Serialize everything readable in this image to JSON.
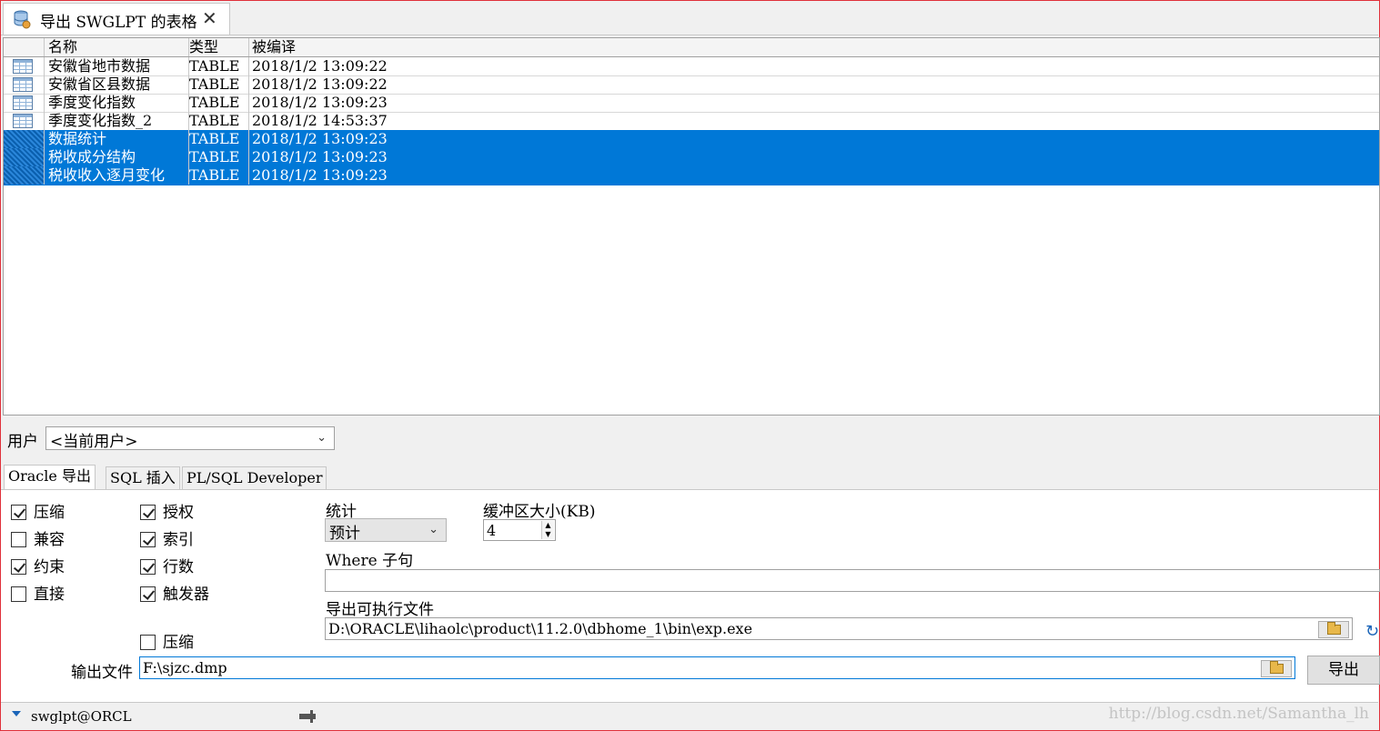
{
  "tab": {
    "title": "导出 SWGLPT 的表格",
    "icon": "database-icon",
    "close": "✕"
  },
  "grid": {
    "columns": [
      "名称",
      "类型",
      "被编译"
    ],
    "rows": [
      {
        "name": "安徽省地市数据",
        "type": "TABLE",
        "compiled": "2018/1/2 13:09:22",
        "selected": false
      },
      {
        "name": "安徽省区县数据",
        "type": "TABLE",
        "compiled": "2018/1/2 13:09:22",
        "selected": false
      },
      {
        "name": "季度变化指数",
        "type": "TABLE",
        "compiled": "2018/1/2 13:09:23",
        "selected": false
      },
      {
        "name": "季度变化指数_2",
        "type": "TABLE",
        "compiled": "2018/1/2 14:53:37",
        "selected": false
      },
      {
        "name": "数据统计",
        "type": "TABLE",
        "compiled": "2018/1/2 13:09:23",
        "selected": true
      },
      {
        "name": "税收成分结构",
        "type": "TABLE",
        "compiled": "2018/1/2 13:09:23",
        "selected": true
      },
      {
        "name": "税收收入逐月变化",
        "type": "TABLE",
        "compiled": "2018/1/2 13:09:23",
        "selected": true
      }
    ]
  },
  "user": {
    "label": "用户",
    "value": "<当前用户>"
  },
  "tabs": [
    "Oracle 导出",
    "SQL 插入",
    "PL/SQL Developer"
  ],
  "options": {
    "col1": [
      {
        "label": "压缩",
        "checked": true
      },
      {
        "label": "兼容",
        "checked": false
      },
      {
        "label": "约束",
        "checked": true
      },
      {
        "label": "直接",
        "checked": false
      }
    ],
    "col2": [
      {
        "label": "授权",
        "checked": true
      },
      {
        "label": "索引",
        "checked": true
      },
      {
        "label": "行数",
        "checked": true
      },
      {
        "label": "触发器",
        "checked": true
      }
    ],
    "compress_output": {
      "label": "压缩",
      "checked": false
    }
  },
  "stats": {
    "label": "统计",
    "value": "预计"
  },
  "buffer": {
    "label": "缓冲区大小(KB)",
    "value": "4"
  },
  "where": {
    "label": "Where 子句",
    "value": ""
  },
  "exe": {
    "label": "导出可执行文件",
    "value": "D:\\ORACLE\\lihaolc\\product\\11.2.0\\dbhome_1\\bin\\exp.exe"
  },
  "output": {
    "label": "输出文件",
    "value": "F:\\sjzc.dmp"
  },
  "export_button": "导出",
  "status": {
    "connection": "swglpt@ORCL",
    "watermark": "http://blog.csdn.net/Samantha_lh"
  }
}
